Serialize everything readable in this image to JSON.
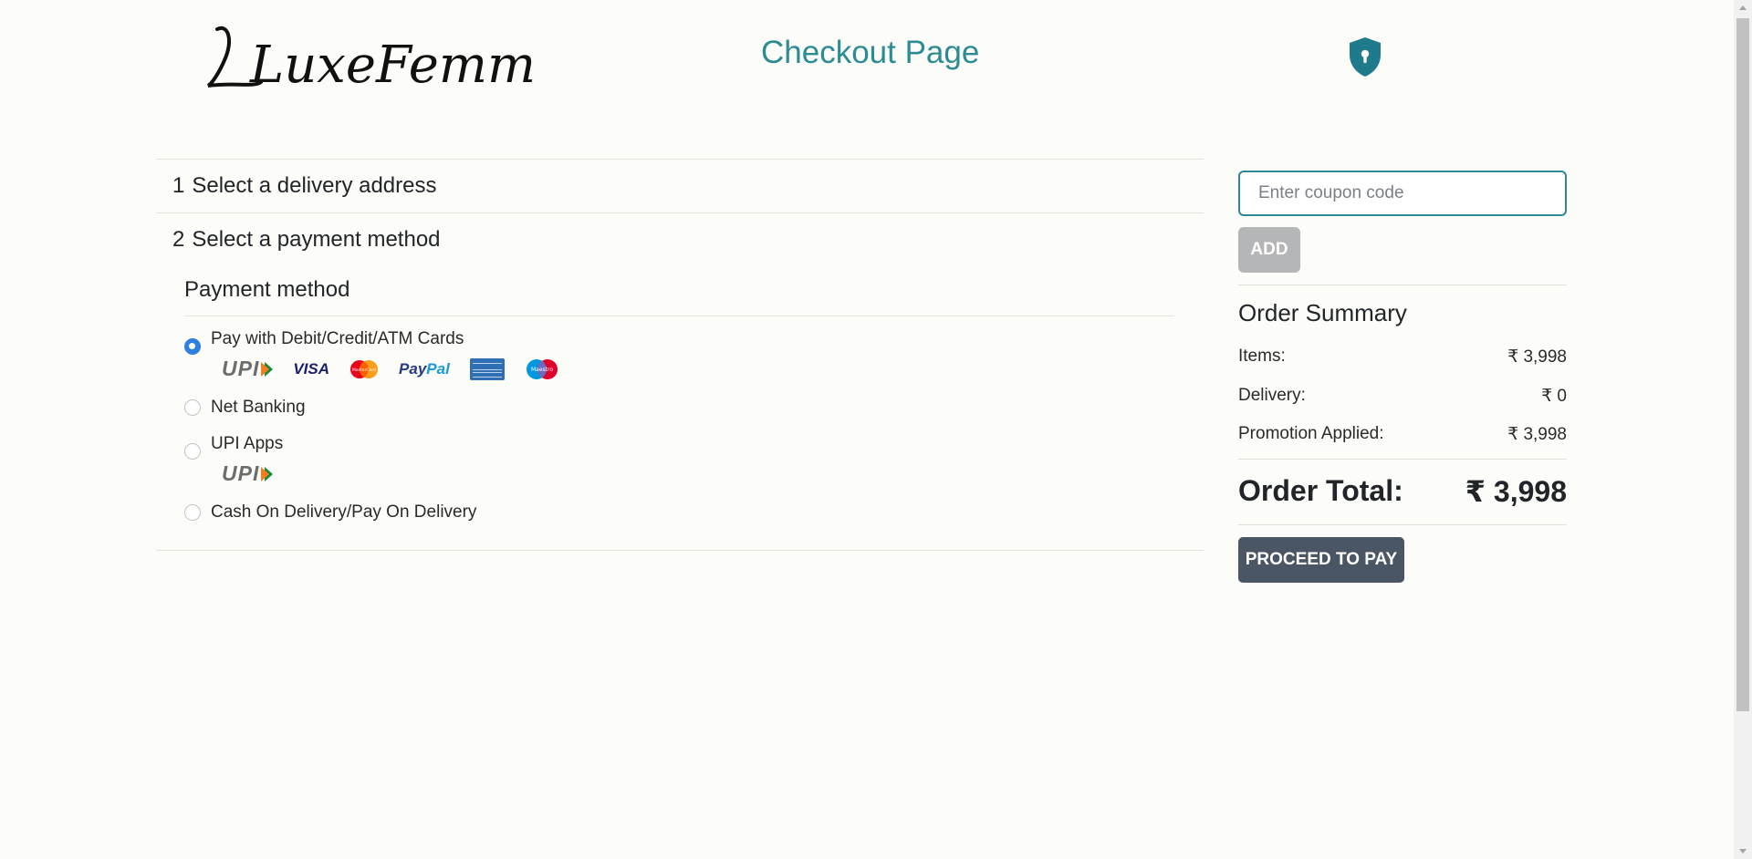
{
  "header": {
    "logo_text": "LuxeFemme",
    "title": "Checkout Page",
    "secure_icon": "shield-keyhole-icon",
    "accent_color": "#2c8b93"
  },
  "checkout": {
    "steps": [
      {
        "number": "1",
        "label": "Select a delivery address"
      },
      {
        "number": "2",
        "label": "Select a payment method"
      }
    ],
    "payment": {
      "heading": "Payment method",
      "options": [
        {
          "label": "Pay with Debit/Credit/ATM Cards",
          "selected": true,
          "logos": [
            "UPI",
            "VISA",
            "MasterCard",
            "PayPal",
            "American Express",
            "Maestro"
          ]
        },
        {
          "label": "Net Banking",
          "selected": false
        },
        {
          "label": "UPI Apps",
          "selected": false,
          "logos": [
            "UPI"
          ]
        },
        {
          "label": "Cash On Delivery/Pay On Delivery",
          "selected": false
        }
      ],
      "logo_text": {
        "upi": "UPI",
        "visa": "VISA",
        "mastercard": "MasterCard",
        "paypal_pay": "Pay",
        "paypal_pal": "Pal",
        "maestro": "Maestro"
      }
    }
  },
  "sidebar": {
    "coupon_placeholder": "Enter coupon code",
    "add_label": "ADD",
    "summary_title": "Order Summary",
    "rows": [
      {
        "label": "Items:",
        "value": "₹ 3,998"
      },
      {
        "label": "Delivery:",
        "value": "₹ 0"
      },
      {
        "label": "Promotion Applied:",
        "value": "₹ 3,998"
      }
    ],
    "total_label": "Order Total:",
    "total_value": "₹ 3,998",
    "proceed_label": "PROCEED TO PAY",
    "pay_button_color": "#4a5664"
  }
}
